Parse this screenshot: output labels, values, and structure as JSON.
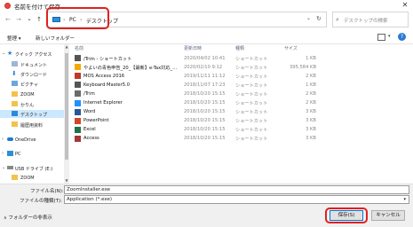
{
  "window": {
    "title": "名前を付けて保存",
    "close_glyph": "✕"
  },
  "nav": {
    "back": "←",
    "forward": "→",
    "dropdown": "⌄",
    "up": "↑",
    "refresh": "↻"
  },
  "address": {
    "crumbs": [
      "PC",
      "デスクトップ"
    ],
    "sep": "›"
  },
  "search": {
    "placeholder": "デスクトップの検索"
  },
  "toolbar": {
    "organize": "整理 ▾",
    "new_folder": "新しいフォルダー"
  },
  "sidebar": {
    "items": [
      {
        "label": "クイック アクセス",
        "icon": "star-icon",
        "color": "#2b7cd3"
      },
      {
        "label": "ドキュメント",
        "icon": "documents-icon",
        "color": "#9fb6d3"
      },
      {
        "label": "ダウンロード",
        "icon": "download-icon",
        "color": "#2b7cd3"
      },
      {
        "label": "ピクチャ",
        "icon": "pictures-icon",
        "color": "#6aa7dc"
      },
      {
        "label": "ZOOM",
        "icon": "folder-icon",
        "color": "#f3c24d"
      },
      {
        "label": "かりん",
        "icon": "folder-icon",
        "color": "#f3c24d"
      },
      {
        "label": "デスクトップ",
        "icon": "desktop-icon",
        "color": "#2b8ad8"
      },
      {
        "label": "履歴用資料",
        "icon": "folder-icon",
        "color": "#f3c24d"
      },
      {
        "label": "OneDrive",
        "icon": "cloud-icon",
        "color": "#1f7ad0"
      },
      {
        "label": "PC",
        "icon": "pc-icon",
        "color": "#2a8fd8"
      },
      {
        "label": "USB ドライブ (E:)",
        "icon": "usb-drive-icon",
        "color": "#888888"
      },
      {
        "label": "ZOOM",
        "icon": "folder-icon",
        "color": "#f3c24d"
      }
    ]
  },
  "columns": {
    "name": "名前",
    "date": "更新日時",
    "type": "種類",
    "size": "サイズ"
  },
  "files": [
    {
      "name": "/Trim - ショートカット",
      "date": "2020/04/02 10:41",
      "type": "ショートカット",
      "size": "1 KB",
      "icon": "shortcut-icon",
      "color": "#555555"
    },
    {
      "name": "やよいの青色申告_20_【最新】e-Tax対応_...",
      "date": "2020/02/10 9:12",
      "type": "ショートカット",
      "size": "395,584 KB",
      "icon": "yayoi-app-icon",
      "color": "#f2a900"
    },
    {
      "name": "MOS Access 2016",
      "date": "2019/11/11 11:12",
      "type": "ショートカット",
      "size": "2 KB",
      "icon": "mos-app-icon",
      "color": "#c0392b"
    },
    {
      "name": "Keyboard Master5.0",
      "date": "2018/11/07 17:23",
      "type": "ショートカット",
      "size": "1 KB",
      "icon": "keyboard-app-icon",
      "color": "#555555"
    },
    {
      "name": "/Trim",
      "date": "2018/10/20 15:15",
      "type": "ショートカット",
      "size": "2 KB",
      "icon": "trim-app-icon",
      "color": "#6b6b6b"
    },
    {
      "name": "Internet Explorer",
      "date": "2018/10/20 15:15",
      "type": "ショートカット",
      "size": "2 KB",
      "icon": "internet-explorer-icon",
      "color": "#1e90ff"
    },
    {
      "name": "Word",
      "date": "2018/10/20 15:15",
      "type": "ショートカット",
      "size": "3 KB",
      "icon": "word-icon",
      "color": "#2b579a"
    },
    {
      "name": "PowerPoint",
      "date": "2018/10/20 15:15",
      "type": "ショートカット",
      "size": "3 KB",
      "icon": "powerpoint-icon",
      "color": "#d24726"
    },
    {
      "name": "Excel",
      "date": "2018/10/20 15:15",
      "type": "ショートカット",
      "size": "3 KB",
      "icon": "excel-icon",
      "color": "#217346"
    },
    {
      "name": "Access",
      "date": "2018/10/20 15:15",
      "type": "ショートカット",
      "size": "3 KB",
      "icon": "access-icon",
      "color": "#a4373a"
    }
  ],
  "bottom": {
    "filename_label": "ファイル名(N):",
    "filename_value": "ZoomInstaller.exe",
    "filetype_label": "ファイルの種類(T):",
    "filetype_value": "Application (*.exe)",
    "hide_folders": "フォルダーの非表示",
    "save": "保存(S)",
    "cancel": "キャンセル"
  }
}
